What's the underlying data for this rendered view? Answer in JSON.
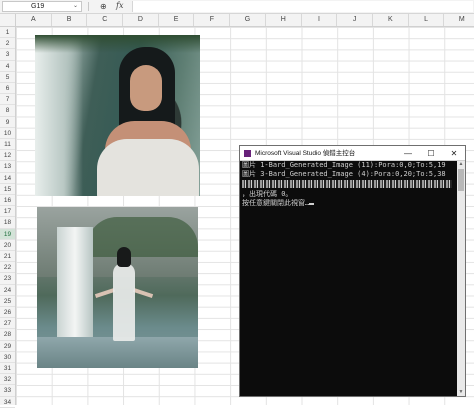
{
  "formula_bar": {
    "cell_ref": "G19",
    "dropdown_icon": "chevron-down-icon",
    "zoom_icon": "zoom-icon",
    "fx_label": "fx"
  },
  "columns": [
    "A",
    "B",
    "C",
    "D",
    "E",
    "F",
    "G",
    "H",
    "I",
    "J",
    "K",
    "L",
    "M"
  ],
  "rows": [
    "1",
    "2",
    "3",
    "4",
    "5",
    "6",
    "7",
    "8",
    "9",
    "10",
    "11",
    "12",
    "13",
    "14",
    "15",
    "16",
    "17",
    "18",
    "19",
    "20",
    "21",
    "22",
    "23",
    "24",
    "25",
    "26",
    "27",
    "28",
    "29",
    "30",
    "31",
    "32",
    "33",
    "34"
  ],
  "selected_row": "19",
  "images": [
    {
      "name": "portrait-woman-waterfall"
    },
    {
      "name": "woman-standing-waterfall-rain"
    }
  ],
  "console": {
    "title": "Microsoft Visual Studio 偵錯主控台",
    "window_buttons": {
      "minimize": "—",
      "maximize": "☐",
      "close": "✕"
    },
    "lines": [
      "圖片 1-Bard_Generated_Image (11):Pora:0,0;To:5,19",
      "圖片 3-Bard_Generated_Image (4):Pora:0,20;To:5,38"
    ],
    "exit_line": "，出現代碼 0。",
    "prompt_line": "按任意鍵關閉此視窗…"
  },
  "colors": {
    "accent_green": "#1e6e3c",
    "console_bg": "#0c0c0c",
    "vs_purple": "#68217a"
  }
}
